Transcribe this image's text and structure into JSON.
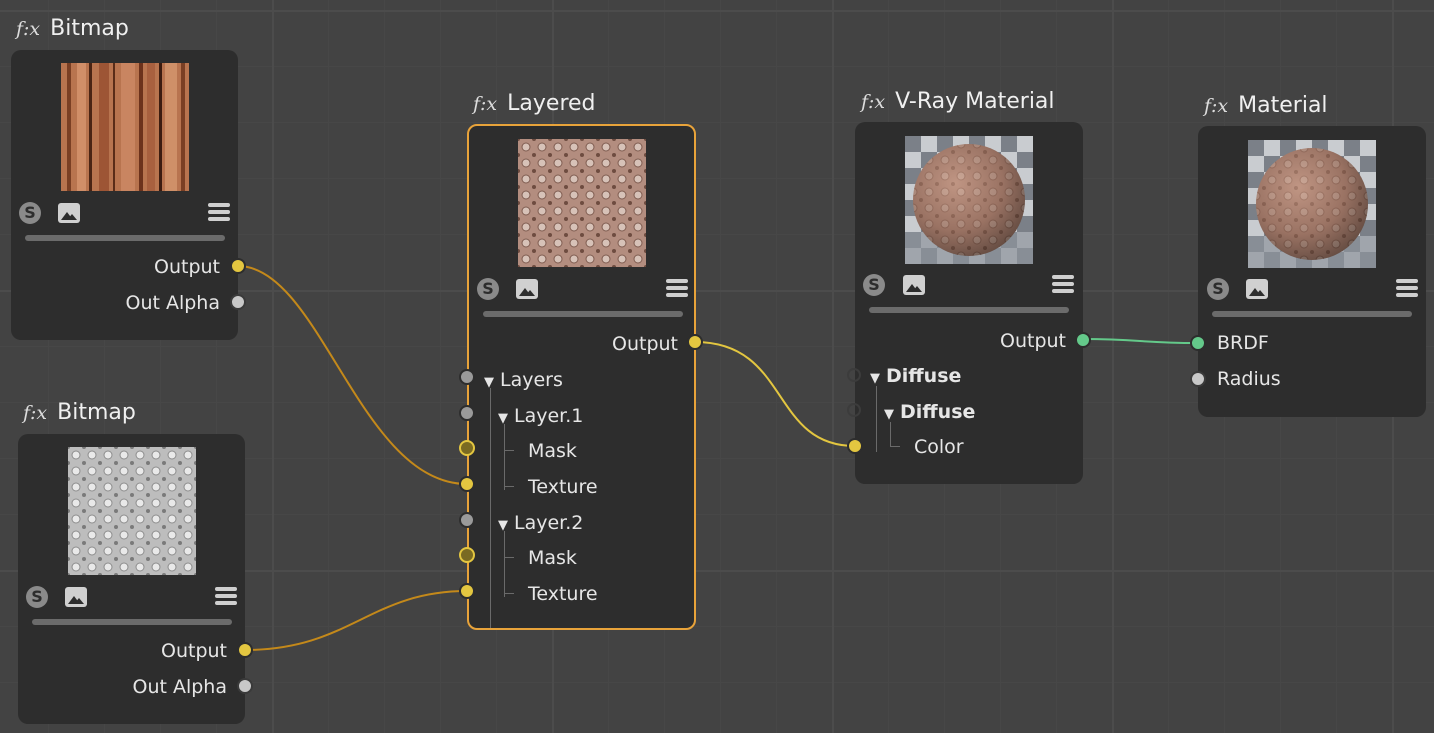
{
  "colors": {
    "background": "#434343",
    "node_bg": "#2d2d2d",
    "selected_border": "#e8a33a",
    "wire_orange": "#c4891a",
    "wire_yellow": "#e3c640",
    "wire_green": "#64c98a"
  },
  "fx_symbol": "f:x",
  "nodes": {
    "bitmap1": {
      "title": "Bitmap",
      "thumbnail": "wood-texture",
      "outputs": [
        "Output",
        "Out Alpha"
      ]
    },
    "bitmap2": {
      "title": "Bitmap",
      "thumbnail": "grey-pattern-texture",
      "outputs": [
        "Output",
        "Out Alpha"
      ]
    },
    "layered": {
      "title": "Layered",
      "selected": true,
      "thumbnail": "layered-texture",
      "output": "Output",
      "inputs": {
        "layers": "Layers",
        "layer1": "Layer.1",
        "layer1_mask": "Mask",
        "layer1_texture": "Texture",
        "layer2": "Layer.2",
        "layer2_mask": "Mask",
        "layer2_texture": "Texture"
      }
    },
    "vray": {
      "title": "V-Ray Material",
      "thumbnail": "sphere-preview",
      "output": "Output",
      "inputs": {
        "diffuse_group": "Diffuse",
        "diffuse_sub": "Diffuse",
        "color": "Color"
      }
    },
    "material": {
      "title": "Material",
      "thumbnail": "sphere-preview",
      "inputs": [
        "BRDF",
        "Radius"
      ]
    }
  },
  "icons": [
    "s-icon",
    "image-icon",
    "menu-icon",
    "expand-triangle-icon"
  ]
}
